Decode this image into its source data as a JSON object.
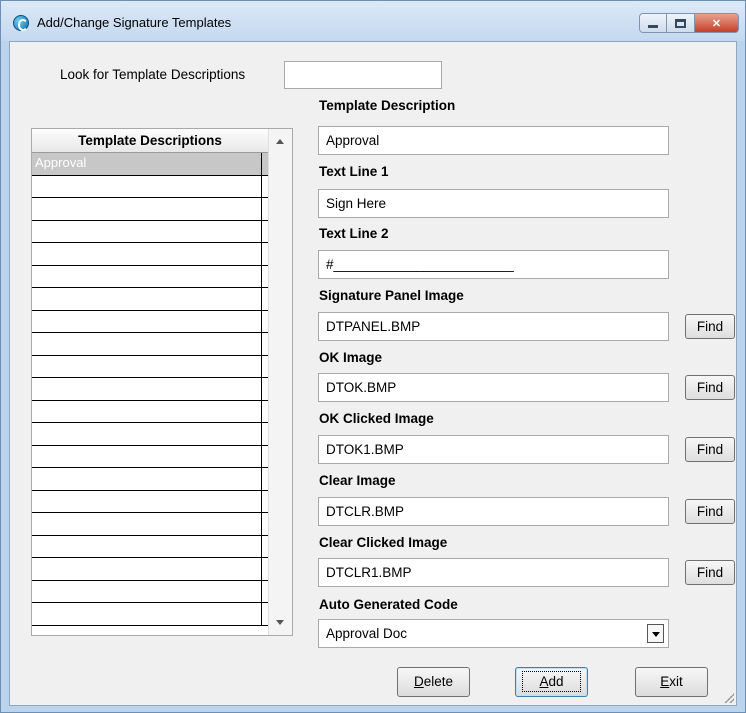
{
  "window": {
    "title": "Add/Change Signature Templates",
    "accent": "#bcd3ec"
  },
  "search": {
    "label": "Look for Template Descriptions",
    "value": ""
  },
  "list": {
    "header": "Template Descriptions",
    "items": [
      "Approval"
    ]
  },
  "fields": {
    "template_description": {
      "label": "Template Description",
      "value": "Approval"
    },
    "text_line_1": {
      "label": "Text Line 1",
      "value": "Sign Here"
    },
    "text_line_2": {
      "label": "Text Line 2",
      "value": "#________________________"
    },
    "signature_panel_image": {
      "label": "Signature Panel Image",
      "value": "DTPANEL.BMP"
    },
    "ok_image": {
      "label": "OK Image",
      "value": "DTOK.BMP"
    },
    "ok_clicked_image": {
      "label": "OK Clicked Image",
      "value": "DTOK1.BMP"
    },
    "clear_image": {
      "label": "Clear Image",
      "value": "DTCLR.BMP"
    },
    "clear_clicked_image": {
      "label": "Clear Clicked Image",
      "value": "DTCLR1.BMP"
    },
    "auto_generated_code": {
      "label": "Auto Generated Code",
      "value": "Approval Doc"
    }
  },
  "buttons": {
    "find": "Find",
    "delete": "Delete",
    "add": "Add",
    "exit": "Exit"
  }
}
